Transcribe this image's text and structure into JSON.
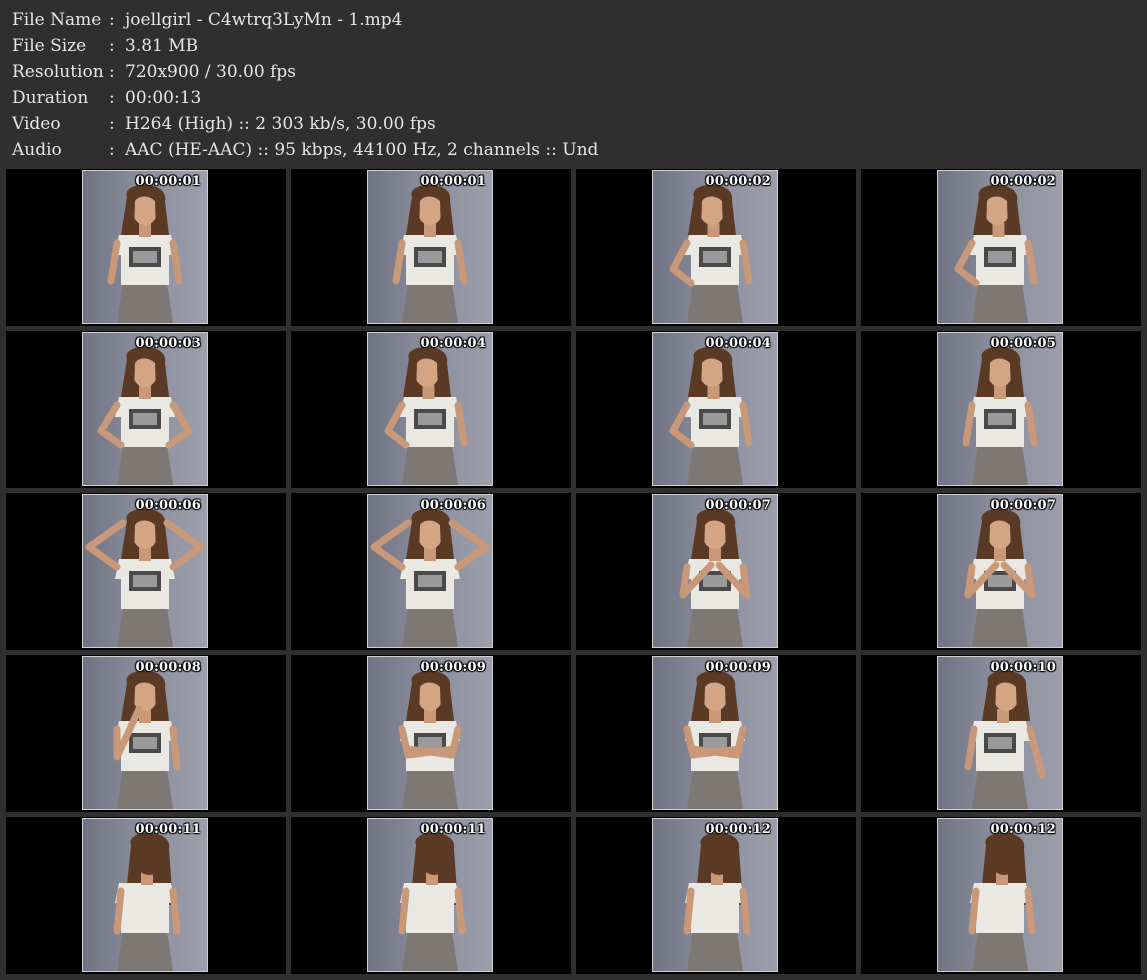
{
  "header": {
    "rows": [
      {
        "label": "File Name",
        "sep": ":",
        "value": "joellgirl - C4wtrq3LyMn - 1.mp4"
      },
      {
        "label": "File Size",
        "sep": ":",
        "value": "3.81 MB"
      },
      {
        "label": "Resolution",
        "sep": ":",
        "value": "720x900 / 30.00 fps"
      },
      {
        "label": "Duration",
        "sep": ":",
        "value": "00:00:13"
      },
      {
        "label": "Video",
        "sep": ":",
        "value": "H264 (High) :: 2 303 kb/s, 30.00 fps"
      },
      {
        "label": "Audio",
        "sep": ":",
        "value": "AAC (HE-AAC) :: 95 kbps, 44100 Hz, 2 channels :: Und"
      }
    ]
  },
  "colors": {
    "background": "#2f2f2f",
    "cell": "#000000",
    "text": "#e6e6e6",
    "frame_border": "#d0d0d0"
  },
  "thumbnails": [
    {
      "timestamp": "00:00:01",
      "pose": "standing"
    },
    {
      "timestamp": "00:00:01",
      "pose": "standing"
    },
    {
      "timestamp": "00:00:02",
      "pose": "hand-on-hip"
    },
    {
      "timestamp": "00:00:02",
      "pose": "hand-on-hip"
    },
    {
      "timestamp": "00:00:03",
      "pose": "hands-on-hips"
    },
    {
      "timestamp": "00:00:04",
      "pose": "hand-on-hip"
    },
    {
      "timestamp": "00:00:04",
      "pose": "hand-on-hip"
    },
    {
      "timestamp": "00:00:05",
      "pose": "standing"
    },
    {
      "timestamp": "00:00:06",
      "pose": "hands-behind-head"
    },
    {
      "timestamp": "00:00:06",
      "pose": "hands-behind-head"
    },
    {
      "timestamp": "00:00:07",
      "pose": "hands-at-chest"
    },
    {
      "timestamp": "00:00:07",
      "pose": "hands-at-chest"
    },
    {
      "timestamp": "00:00:08",
      "pose": "hand-at-chin"
    },
    {
      "timestamp": "00:00:09",
      "pose": "arms-crossed"
    },
    {
      "timestamp": "00:00:09",
      "pose": "arms-crossed"
    },
    {
      "timestamp": "00:00:10",
      "pose": "turning"
    },
    {
      "timestamp": "00:00:11",
      "pose": "back-view"
    },
    {
      "timestamp": "00:00:11",
      "pose": "back-view"
    },
    {
      "timestamp": "00:00:12",
      "pose": "back-view"
    },
    {
      "timestamp": "00:00:12",
      "pose": "back-view"
    }
  ]
}
